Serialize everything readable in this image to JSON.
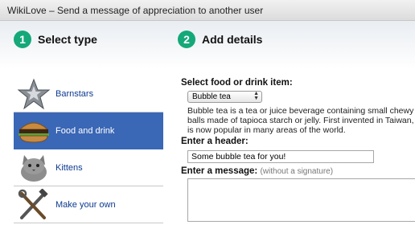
{
  "window": {
    "title": "WikiLove – Send a message of appreciation to another user"
  },
  "steps": [
    {
      "number": "1",
      "title": "Select type"
    },
    {
      "number": "2",
      "title": "Add details"
    }
  ],
  "types": [
    {
      "label": "Barnstars",
      "icon": "barnstar-icon",
      "selected": false
    },
    {
      "label": "Food and drink",
      "icon": "burger-icon",
      "selected": true
    },
    {
      "label": "Kittens",
      "icon": "kitten-icon",
      "selected": false
    },
    {
      "label": "Make your own",
      "icon": "tools-icon",
      "selected": false
    }
  ],
  "details": {
    "food_label": "Select food or drink item:",
    "food_selected": "Bubble tea",
    "description": "Bubble tea is a tea or juice beverage containing small chewy balls made of tapioca starch or jelly. First invented in Taiwan, it is now popular in many areas of the world.",
    "header_label": "Enter a header:",
    "header_value": "Some bubble tea for you!",
    "message_label": "Enter a message:",
    "message_hint": "(without a signature)",
    "message_value": ""
  },
  "colors": {
    "accent": "#15a879",
    "selection": "#3a67b6",
    "link": "#0c3a8f"
  }
}
